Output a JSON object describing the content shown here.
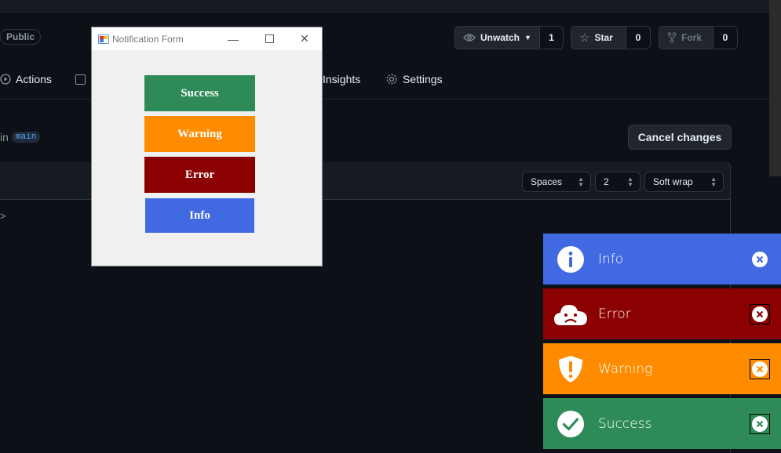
{
  "repo": {
    "visibility": "Public",
    "watch": {
      "label": "Unwatch",
      "count": "1"
    },
    "star": {
      "label": "Star",
      "count": "0"
    },
    "fork": {
      "label": "Fork",
      "count": "0"
    }
  },
  "tabs": [
    {
      "label": "Actions"
    },
    {
      "label": "Insights"
    },
    {
      "label": "Settings"
    }
  ],
  "editor": {
    "in_text": "in",
    "branch": "main",
    "cancel_label": "Cancel changes",
    "indent_mode": "Spaces",
    "indent_size": "2",
    "wrap_mode": "Soft wrap",
    "gutter_glyph": ">"
  },
  "form": {
    "title": "Notification Form",
    "buttons": {
      "success": "Success",
      "warning": "Warning",
      "error": "Error",
      "info": "Info"
    }
  },
  "notifications": {
    "info": {
      "label": "Info",
      "color": "#4169e1",
      "icon": "info-icon"
    },
    "error": {
      "label": "Error",
      "color": "#8b0000",
      "icon": "sad-cloud-icon"
    },
    "warning": {
      "label": "Warning",
      "color": "#ff8c00",
      "icon": "shield-exclamation-icon"
    },
    "success": {
      "label": "Success",
      "color": "#2e8b57",
      "icon": "check-circle-icon"
    }
  }
}
